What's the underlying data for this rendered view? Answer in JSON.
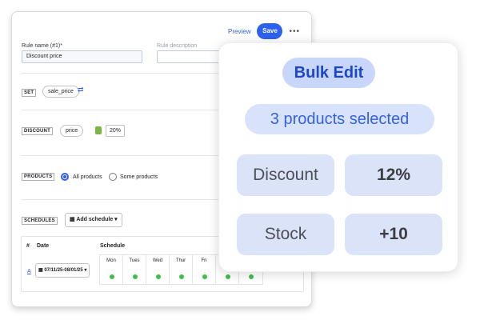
{
  "topbar": {
    "preview": "Preview",
    "save": "Save",
    "more": "•••"
  },
  "rule": {
    "name_label": "Rule name (#1)*",
    "name_value": "Discount price",
    "desc_placeholder": "Rule description"
  },
  "set": {
    "tag": "SET",
    "field": "sale_price"
  },
  "discount": {
    "tag": "DISCOUNT",
    "field": "price",
    "value": "20%"
  },
  "products": {
    "tag": "PRODUCTS",
    "option_all": "All products",
    "option_some": "Some products",
    "selected": "All products"
  },
  "schedules": {
    "tag": "SCHEDULES",
    "add_button": "Add schedule",
    "headers": {
      "num": "#",
      "date": "Date",
      "schedule": "Schedule"
    },
    "rows": [
      {
        "link": "A",
        "date": "07/11/25-08/01/25"
      }
    ],
    "days": [
      "Mon",
      "Tues",
      "Wed",
      "Thur",
      "Fri",
      "",
      ""
    ]
  },
  "bulk": {
    "title": "Bulk Edit",
    "subtitle": "3 products selected",
    "rows": [
      {
        "label": "Discount",
        "value": "12%"
      },
      {
        "label": "Stock",
        "value": "+10"
      }
    ]
  },
  "colors": {
    "accent": "#2d62f0",
    "overlay_title_bg": "#c8d6fb",
    "chip_bg": "#dbe3f8",
    "active_dot": "#3fbf4a"
  }
}
